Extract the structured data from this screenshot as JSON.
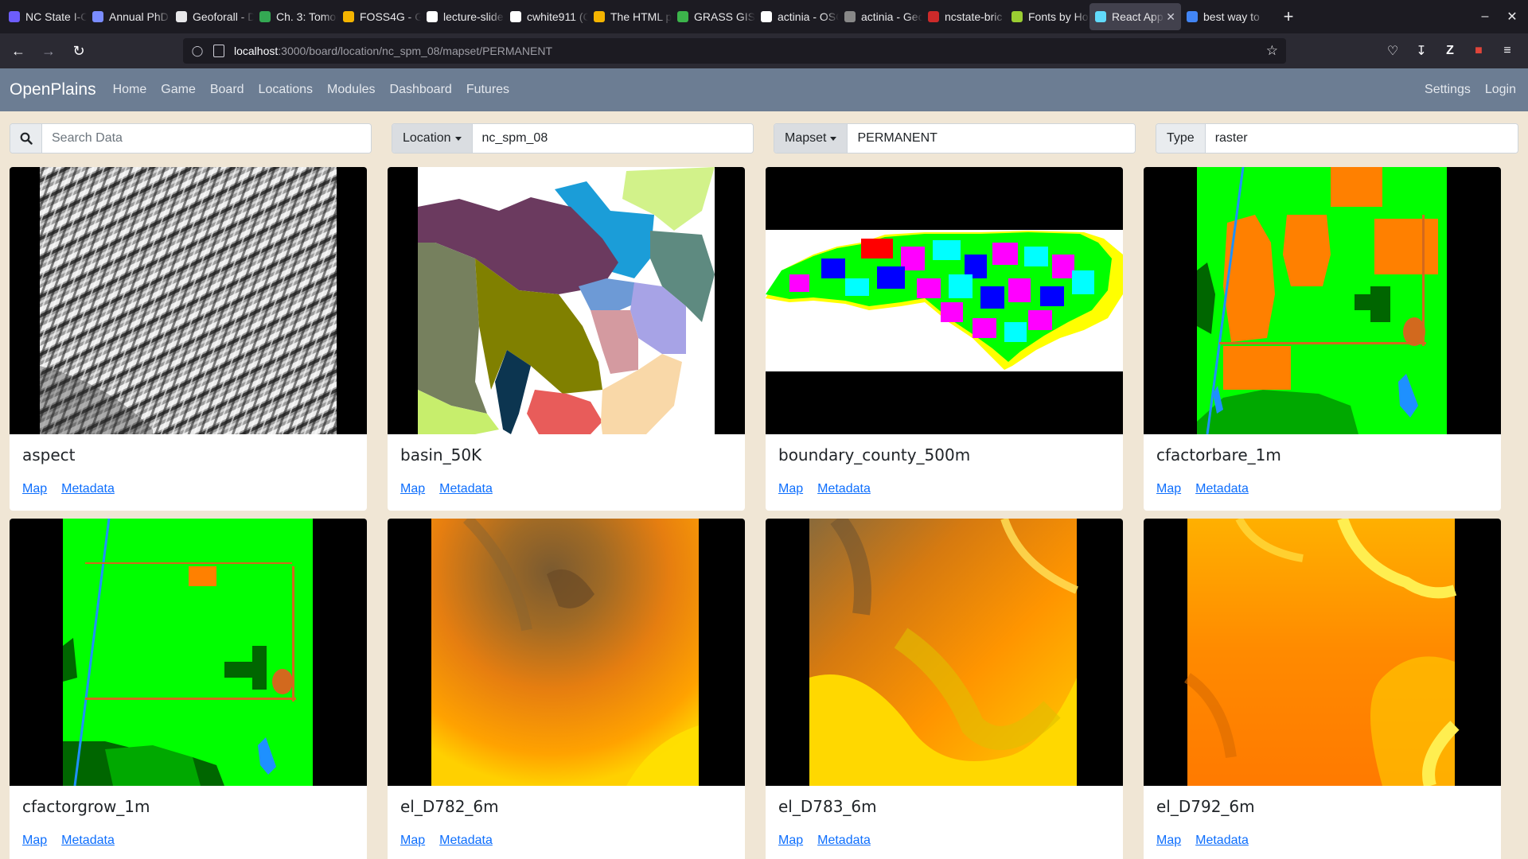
{
  "browser": {
    "tabs": [
      {
        "title": "NC State I-C",
        "color": "#6d5dfc"
      },
      {
        "title": "Annual PhD",
        "color": "#7a8cff"
      },
      {
        "title": "Geoforall - D",
        "color": "#e8e8ea"
      },
      {
        "title": "Ch. 3: Tomor",
        "color": "#34a853"
      },
      {
        "title": "FOSS4G - Go",
        "color": "#f4b400"
      },
      {
        "title": "lecture-slide",
        "color": "#ffffff"
      },
      {
        "title": "cwhite911 (C",
        "color": "#ffffff"
      },
      {
        "title": "The HTML pr",
        "color": "#f4b400"
      },
      {
        "title": "GRASS GIS -",
        "color": "#3cb44b"
      },
      {
        "title": "actinia - OSG",
        "color": "#ffffff"
      },
      {
        "title": "actinia - Geo",
        "color": "#888888"
      },
      {
        "title": "ncstate-bric",
        "color": "#cc2a2a"
      },
      {
        "title": "Fonts by Ho",
        "color": "#9acd32"
      },
      {
        "title": "React App",
        "color": "#61dafb",
        "active": true
      },
      {
        "title": "best way to",
        "color": "#4285f4"
      }
    ],
    "url_host": "localhost",
    "url_path": ":3000/board/location/nc_spm_08/mapset/PERMANENT"
  },
  "app": {
    "brand": "OpenPlains",
    "nav": [
      "Home",
      "Game",
      "Board",
      "Locations",
      "Modules",
      "Dashboard",
      "Futures"
    ],
    "nav_right": [
      "Settings",
      "Login"
    ]
  },
  "filters": {
    "search_placeholder": "Search Data",
    "location_label": "Location",
    "location_value": "nc_spm_08",
    "mapset_label": "Mapset",
    "mapset_value": "PERMANENT",
    "type_label": "Type",
    "type_value": "raster"
  },
  "cards": [
    {
      "name": "aspect",
      "map": "Map",
      "meta": "Metadata",
      "thumb": "aspect"
    },
    {
      "name": "basin_50K",
      "map": "Map",
      "meta": "Metadata",
      "thumb": "basin"
    },
    {
      "name": "boundary_county_500m",
      "map": "Map",
      "meta": "Metadata",
      "thumb": "county"
    },
    {
      "name": "cfactorbare_1m",
      "map": "Map",
      "meta": "Metadata",
      "thumb": "cfbare"
    },
    {
      "name": "cfactorgrow_1m",
      "map": "Map",
      "meta": "Metadata",
      "thumb": "cfgrow"
    },
    {
      "name": "el_D782_6m",
      "map": "Map",
      "meta": "Metadata",
      "thumb": "el782"
    },
    {
      "name": "el_D783_6m",
      "map": "Map",
      "meta": "Metadata",
      "thumb": "el783"
    },
    {
      "name": "el_D792_6m",
      "map": "Map",
      "meta": "Metadata",
      "thumb": "el792"
    }
  ]
}
